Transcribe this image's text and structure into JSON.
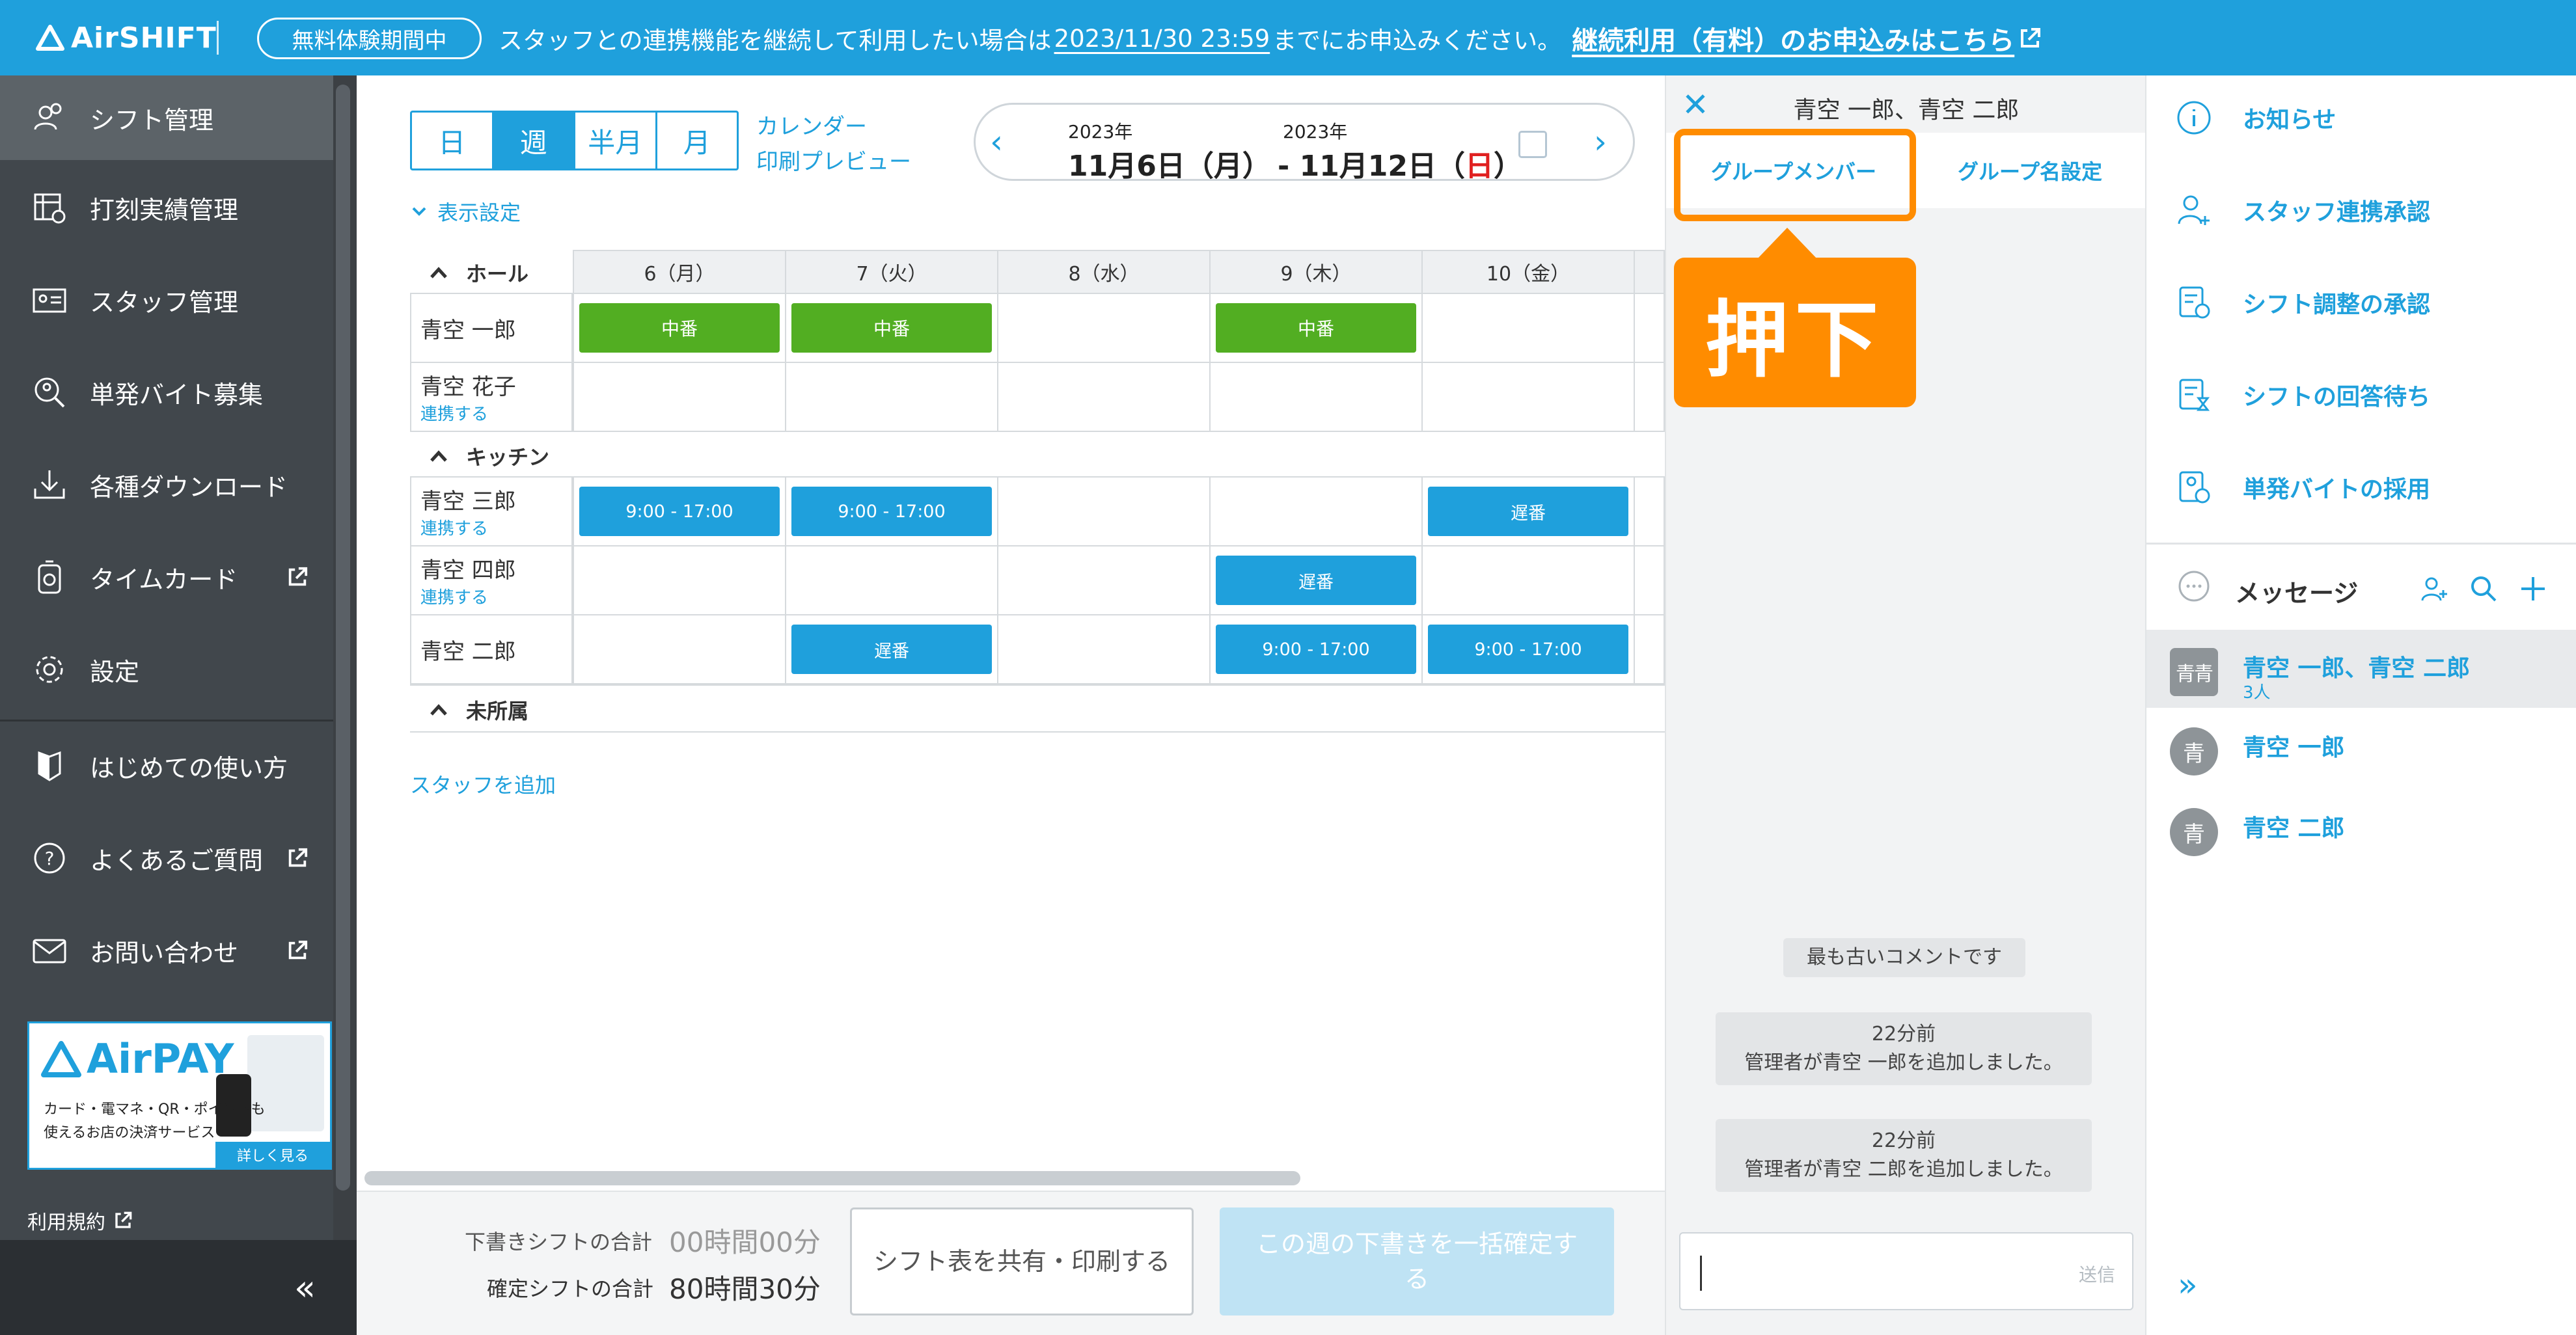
{
  "topbar": {
    "logo": "AirSHIFT",
    "trial_badge": "無料体験期間中",
    "notice_prefix": "スタッフとの連携機能を継続して利用したい場合は",
    "notice_deadline": "2023/11/30 23:59",
    "notice_suffix": "までにお申込みください。",
    "cta": "継続利用（有料）のお申込みはこちら",
    "brand_color": "#1fa0dc"
  },
  "sidebar": {
    "items": [
      {
        "label": "シフト管理",
        "icon": "people-icon",
        "active": true
      },
      {
        "label": "打刻実績管理",
        "icon": "timesheet-icon"
      },
      {
        "label": "スタッフ管理",
        "icon": "staff-card-icon"
      },
      {
        "label": "単発バイト募集",
        "icon": "search-person-icon"
      },
      {
        "label": "各種ダウンロード",
        "icon": "download-icon"
      },
      {
        "label": "タイムカード",
        "icon": "timecard-icon",
        "external": true
      },
      {
        "label": "設定",
        "icon": "gear-icon"
      },
      {
        "label": "はじめての使い方",
        "icon": "shield-icon"
      },
      {
        "label": "よくあるご質問",
        "icon": "question-icon",
        "external": true
      },
      {
        "label": "お問い合わせ",
        "icon": "mail-icon",
        "external": true
      }
    ],
    "banner": {
      "logo": "AirPAY",
      "line1": "カード・電マネ・QR・ポイントも",
      "line2": "使えるお店の決済サービス",
      "more": "詳しく見る"
    },
    "terms": "利用規約",
    "collapse": "«"
  },
  "toolbar": {
    "views": [
      "日",
      "週",
      "半月",
      "月"
    ],
    "selected_view": "週",
    "calendar_link_1": "カレンダー",
    "calendar_link_2": "印刷プレビュー",
    "start_year": "2023年",
    "start_date": "11月6日（月）",
    "end_year": "2023年",
    "end_prefix": "- 11月12日（",
    "end_day": "日",
    "end_suffix": "）",
    "display_settings": "表示設定"
  },
  "schedule": {
    "days": [
      "6（月）",
      "7（火）",
      "8（水）",
      "9（木）",
      "10（金）"
    ],
    "sections": [
      {
        "name": "ホール",
        "staff": [
          {
            "name": "青空 一郎",
            "link": "",
            "shifts": [
              "中番",
              "中番",
              "",
              "中番",
              ""
            ],
            "colors": [
              "green",
              "green",
              "",
              "green",
              ""
            ]
          },
          {
            "name": "青空 花子",
            "link": "連携する",
            "shifts": [
              "",
              "",
              "",
              "",
              ""
            ],
            "colors": [
              "",
              "",
              "",
              "",
              ""
            ]
          }
        ]
      },
      {
        "name": "キッチン",
        "staff": [
          {
            "name": "青空 三郎",
            "link": "連携する",
            "shifts": [
              "9:00 - 17:00",
              "9:00 - 17:00",
              "",
              "",
              "遅番"
            ],
            "colors": [
              "blue",
              "blue",
              "",
              "",
              "blue"
            ]
          },
          {
            "name": "青空 四郎",
            "link": "連携する",
            "shifts": [
              "",
              "",
              "",
              "遅番",
              ""
            ],
            "colors": [
              "",
              "",
              "",
              "blue",
              ""
            ]
          },
          {
            "name": "青空 二郎",
            "link": "",
            "shifts": [
              "",
              "遅番",
              "",
              "9:00 - 17:00",
              "9:00 - 17:00"
            ],
            "colors": [
              "",
              "blue",
              "",
              "blue",
              "blue"
            ]
          }
        ]
      },
      {
        "name": "未所属",
        "staff": []
      }
    ],
    "add_staff": "スタッフを追加"
  },
  "footer": {
    "draft_label": "下書きシフトの合計",
    "draft_value": "00時間00分",
    "confirmed_label": "確定シフトの合計",
    "confirmed_value": "80時間30分",
    "share_button": "シフト表を共有・印刷する",
    "confirm_button": "この週の下書きを一括確定する"
  },
  "chat": {
    "title": "青空 一郎、青空 二郎",
    "tab_members": "グループメンバー",
    "tab_group_name": "グループ名設定",
    "callout": "押下",
    "oldest": "最も古いコメントです",
    "messages": [
      {
        "time": "22分前",
        "text": "管理者が青空 一郎を追加しました。"
      },
      {
        "time": "22分前",
        "text": "管理者が青空 二郎を追加しました。"
      }
    ],
    "input_placeholder": "",
    "send": "送信",
    "accent_color": "#ff8c00"
  },
  "right_panel": {
    "items": [
      {
        "label": "お知らせ",
        "icon": "info-icon"
      },
      {
        "label": "スタッフ連携承認",
        "icon": "person-add-icon"
      },
      {
        "label": "シフト調整の承認",
        "icon": "approve-doc-icon"
      },
      {
        "label": "シフトの回答待ち",
        "icon": "hourglass-doc-icon"
      },
      {
        "label": "単発バイトの採用",
        "icon": "hire-doc-icon"
      }
    ],
    "messages_title": "メッセージ",
    "conversations": [
      {
        "avatar": "青青",
        "name": "青空 一郎、青空 二郎",
        "count": "3人",
        "selected": true
      },
      {
        "avatar": "青",
        "name": "青空 一郎",
        "count": ""
      },
      {
        "avatar": "青",
        "name": "青空 二郎",
        "count": ""
      }
    ],
    "expand": "»"
  }
}
